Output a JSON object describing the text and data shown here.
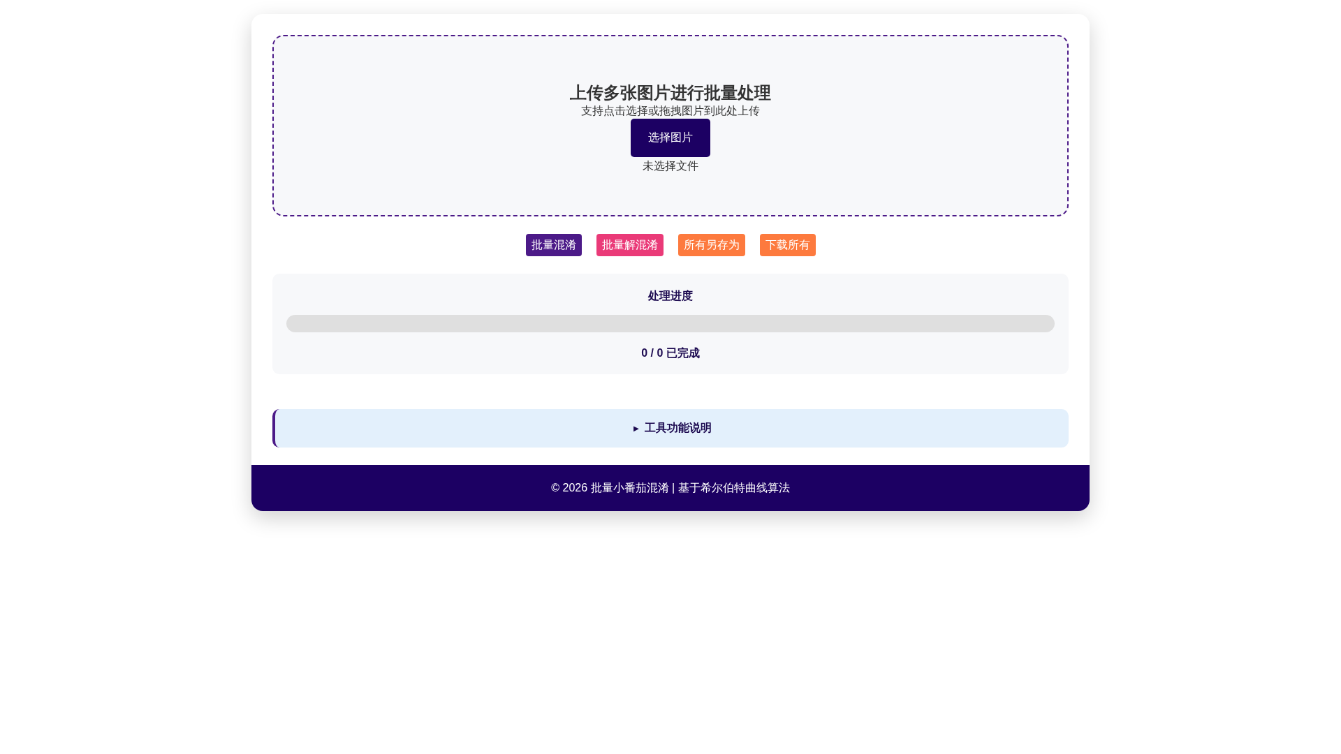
{
  "upload": {
    "title": "上传多张图片进行批量处理",
    "hint": "支持点击选择或拖拽图片到此处上传",
    "button": "选择图片",
    "file_status": "未选择文件"
  },
  "actions": [
    {
      "label": "批量混淆",
      "color": "#4c1a88"
    },
    {
      "label": "批量解混淆",
      "color": "#ea3a78"
    },
    {
      "label": "所有另存为",
      "color": "#fd7a3e"
    },
    {
      "label": "下载所有",
      "color": "#fd7a3e"
    }
  ],
  "progress": {
    "title": "处理进度",
    "level": 0,
    "count": "0 / 0 已完成"
  },
  "details": {
    "marker": "►",
    "title": "工具功能说明",
    "expanded": false
  },
  "footer": "© 2026 批量小番茄混淆 | 基于希尔伯特曲线算法"
}
